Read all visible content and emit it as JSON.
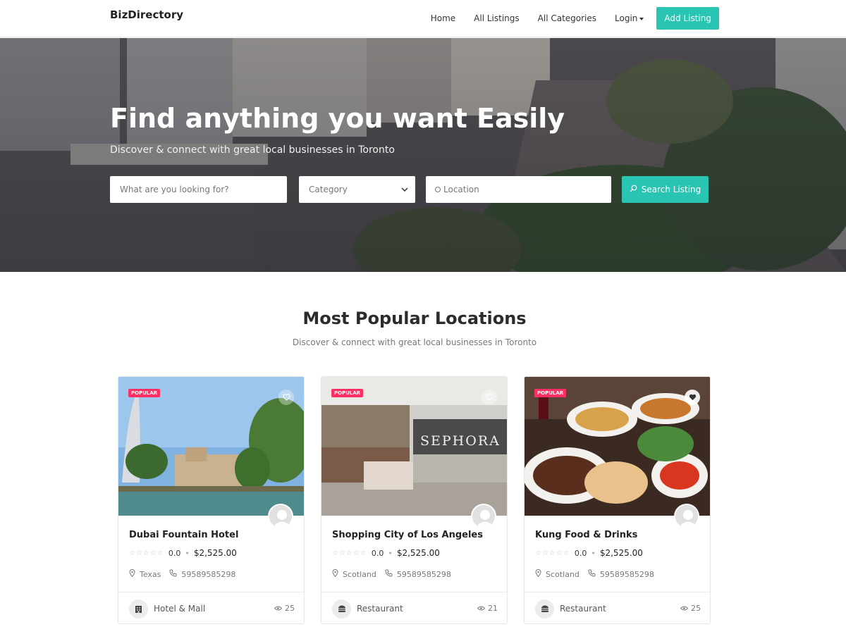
{
  "nav": {
    "brand": "BizDirectory",
    "links": [
      "Home",
      "All Listings",
      "All Categories",
      "Login"
    ],
    "add_listing": "Add Listing"
  },
  "hero": {
    "title": "Find anything you want Easily",
    "subtitle": "Discover & connect with great local businesses in Toronto",
    "search_placeholder": "What are you looking for?",
    "category_value": "Category",
    "location_placeholder": "Location",
    "search_button": "Search Listing"
  },
  "section": {
    "title": "Most Popular Locations",
    "subtitle": "Discover & connect with great local businesses in Toronto"
  },
  "colors": {
    "accent": "#2ac4b3",
    "badge": "#ff2e63"
  },
  "cards": [
    {
      "badge": "POPULAR",
      "title": "Dubai Fountain Hotel",
      "rating": "0.0",
      "price": "$2,525.00",
      "location": "Texas",
      "phone": "59589585298",
      "category": "Hotel & Mall",
      "category_icon": "building-icon",
      "views": "25",
      "favorited": false
    },
    {
      "badge": "POPULAR",
      "title": "Shopping City of Los Angeles",
      "rating": "0.0",
      "price": "$2,525.00",
      "location": "Scotland",
      "phone": "59589585298",
      "category": "Restaurant",
      "category_icon": "burger-icon",
      "views": "21",
      "favorited": false
    },
    {
      "badge": "POPULAR",
      "title": "Kung Food & Drinks",
      "rating": "0.0",
      "price": "$2,525.00",
      "location": "Scotland",
      "phone": "59589585298",
      "category": "Restaurant",
      "category_icon": "burger-icon",
      "views": "25",
      "favorited": true
    }
  ]
}
